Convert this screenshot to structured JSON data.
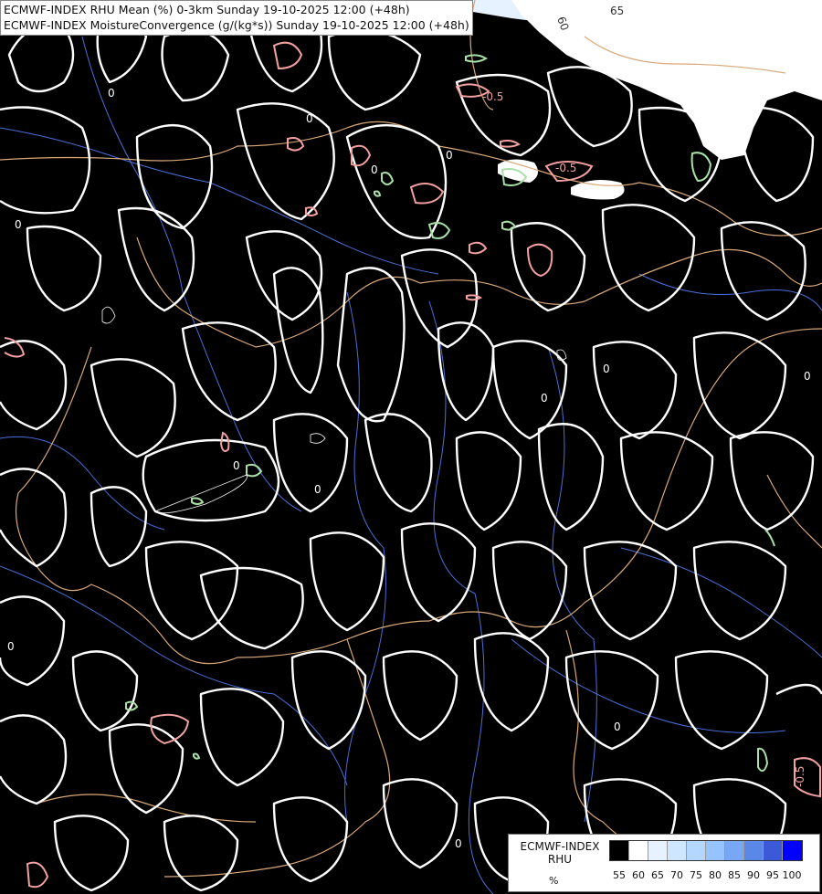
{
  "title": {
    "line1": "ECMWF-INDEX RHU Mean (%) 0-3km Sunday 19-10-2025 12:00 (+48h)",
    "line2": "ECMWF-INDEX MoistureConvergence (g/(kg*s)) Sunday 19-10-2025 12:00 (+48h)"
  },
  "legend": {
    "title_line1": "ECMWF-INDEX",
    "title_line2": "RHU",
    "unit": "%",
    "levels": [
      "55",
      "60",
      "65",
      "70",
      "75",
      "80",
      "85",
      "90",
      "95",
      "100"
    ],
    "colors": [
      "#000000",
      "#ffffff",
      "#e6f2ff",
      "#cfe6ff",
      "#b4d7ff",
      "#96c3ff",
      "#78a8f5",
      "#5a88e8",
      "#3c5ad8",
      "#0000ff"
    ]
  },
  "contour_labels": {
    "zero": "0",
    "neg": "-0.5",
    "v60": "60",
    "v65": "65"
  },
  "style": {
    "contour_zero": "#ffffff",
    "contour_neg": "#f2a0a0",
    "contour_pos": "#a8e0a8",
    "borders": "#d8a878",
    "rivers": "#4a6fd8",
    "humid_fill": "#ffffff",
    "humid_fill_light": "#e6f2ff"
  }
}
